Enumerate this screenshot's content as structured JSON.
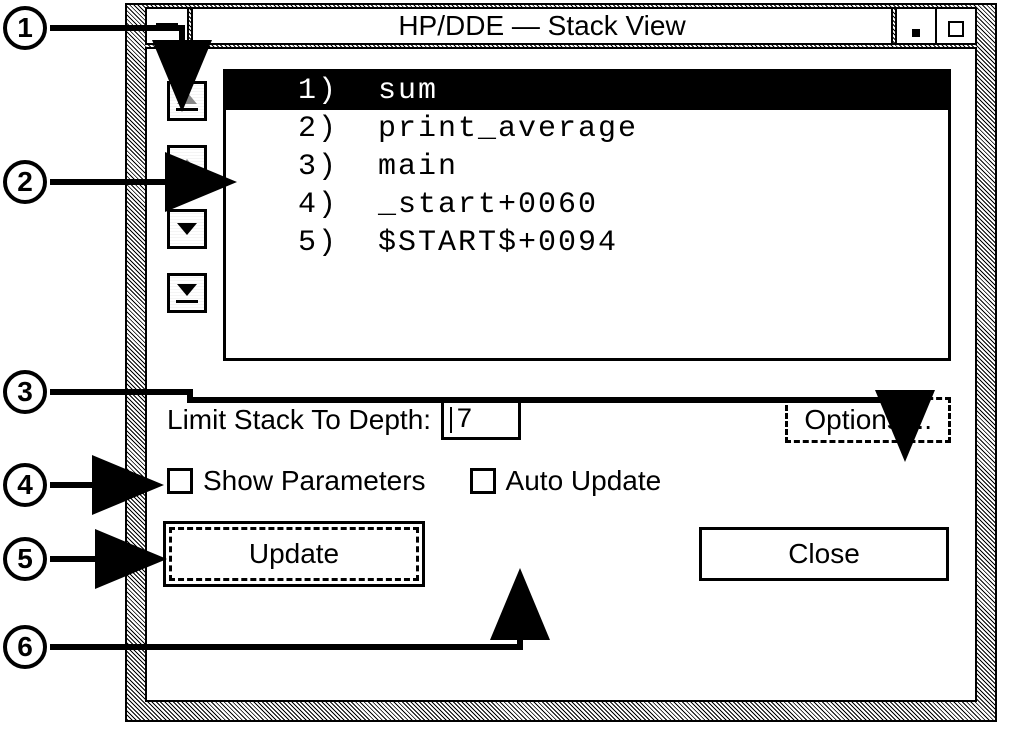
{
  "window": {
    "title": "HP/DDE — Stack View"
  },
  "stack": {
    "items": [
      {
        "n": "1)",
        "name": "sum",
        "selected": true
      },
      {
        "n": "2)",
        "name": "print_average",
        "selected": false
      },
      {
        "n": "3)",
        "name": "main",
        "selected": false
      },
      {
        "n": "4)",
        "name": "_start+0060",
        "selected": false
      },
      {
        "n": "5)",
        "name": "$START$+0094",
        "selected": false
      }
    ]
  },
  "controls": {
    "depth_label": "Limit Stack To Depth:",
    "depth_value": "7",
    "options_label": "Options ...",
    "show_params_label": "Show Parameters",
    "auto_update_label": "Auto Update",
    "update_label": "Update",
    "close_label": "Close"
  },
  "callouts": {
    "c1": "1",
    "c2": "2",
    "c3": "3",
    "c4": "4",
    "c5": "5",
    "c6": "6"
  }
}
